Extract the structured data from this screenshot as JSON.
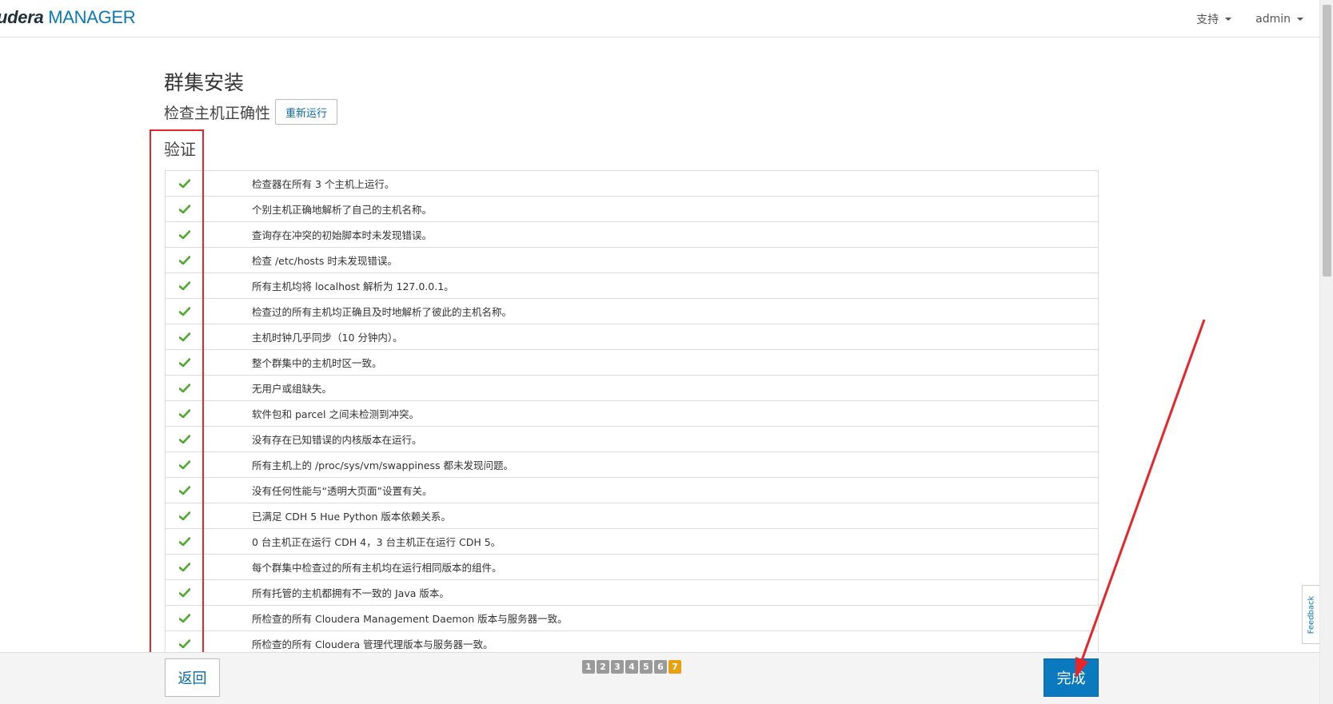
{
  "header": {
    "brand_prefix": "udera",
    "brand_suffix": "MANAGER",
    "support_label": "支持",
    "user_label": "admin"
  },
  "main": {
    "title": "群集安装",
    "subtitle": "检查主机正确性",
    "rerun_label": "重新运行",
    "section_title": "验证",
    "checks": [
      "检查器在所有 3 个主机上运行。",
      "个别主机正确地解析了自己的主机名称。",
      "查询存在冲突的初始脚本时未发现错误。",
      "检查 /etc/hosts 时未发现错误。",
      "所有主机均将 localhost 解析为 127.0.0.1。",
      "检查过的所有主机均正确且及时地解析了彼此的主机名称。",
      "主机时钟几乎同步（10 分钟内）。",
      "整个群集中的主机时区一致。",
      "无用户或组缺失。",
      "软件包和 parcel 之间未检测到冲突。",
      "没有存在已知错误的内核版本在运行。",
      "所有主机上的 /proc/sys/vm/swappiness 都未发现问题。",
      "没有任何性能与“透明大页面”设置有关。",
      "已满足 CDH 5 Hue Python 版本依赖关系。",
      "0 台主机正在运行 CDH 4，3 台主机正在运行 CDH 5。",
      "每个群集中检查过的所有主机均在运行相同版本的组件。",
      "所有托管的主机都拥有不一致的 Java 版本。",
      "所检查的所有 Cloudera Management Daemon 版本与服务器一致。",
      "所检查的所有 Cloudera 管理代理版本与服务器一致。"
    ],
    "check_icon": "checkmark-icon"
  },
  "footer": {
    "back_label": "返回",
    "finish_label": "完成",
    "steps": [
      "1",
      "2",
      "3",
      "4",
      "5",
      "6",
      "7"
    ],
    "active_step": "7"
  },
  "feedback_label": "Feedback",
  "colors": {
    "accent": "#0a79bd",
    "check": "#4eaa2f",
    "active_step": "#e8a10c",
    "annotation": "#e8252b"
  }
}
